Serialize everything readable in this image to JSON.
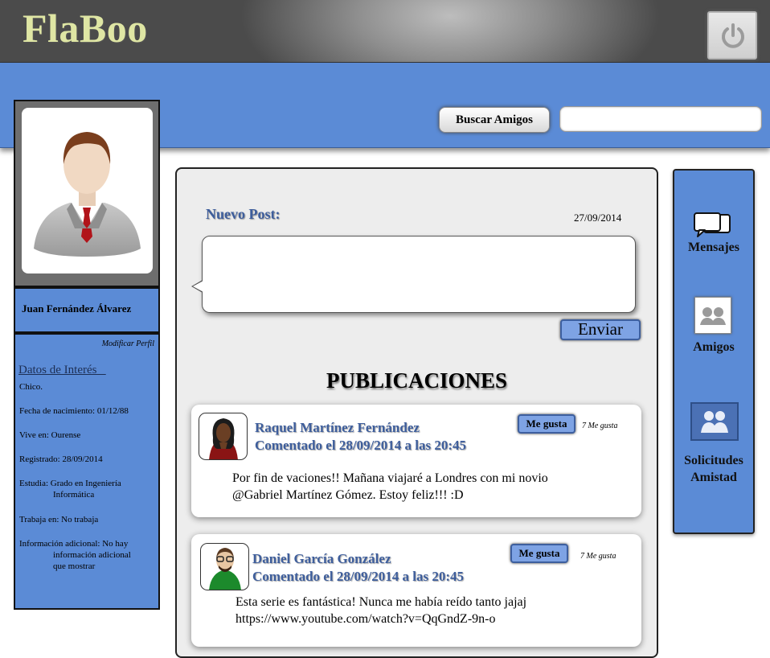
{
  "header": {
    "logo": "FlaBoo",
    "power_icon": "power-icon"
  },
  "search": {
    "button_label": "Buscar Amigos",
    "placeholder": ""
  },
  "profile": {
    "name": "Juan Fernández Álvarez",
    "modify_link": "Modificar Perfil",
    "interest_title": "Datos de Interés",
    "lines": [
      "Chico.",
      "Fecha de nacimiento: 01/12/88",
      "Vive en: Ourense",
      "Registrado: 28/09/2014"
    ],
    "studies_label": "Estudia: Grado en Ingeniería",
    "studies_cont": "Informática",
    "works": "Trabaja en: No trabaja",
    "extra_label": "Información adicional: No hay",
    "extra_cont1": "información adicional",
    "extra_cont2": "que mostrar"
  },
  "composer": {
    "title": "Nuevo Post:",
    "date": "27/09/2014",
    "send_label": "Enviar"
  },
  "feed": {
    "title": "PUBLICACIONES",
    "posts": [
      {
        "author": "Raquel Martínez Fernández",
        "meta": "Comentado el 28/09/2014 a las 20:45",
        "like_label": "Me gusta",
        "likes": "7 Me gusta",
        "body_line1": "Por fin de vaciones!! Mañana viajaré a Londres con mi novio",
        "body_line2": "@Gabriel Martínez Gómez. Estoy feliz!!! :D"
      },
      {
        "author": "Daniel García González",
        "meta": "Comentado el 28/09/2014 a las 20:45",
        "like_label": "Me gusta",
        "likes": "7 Me gusta",
        "body_line1": "Esta serie es fantástica! Nunca me había reído tanto jajaj",
        "body_line2": "https://www.youtube.com/watch?v=QqGndZ-9n-o"
      }
    ]
  },
  "sidebar_right": {
    "messages": "Mensajes",
    "friends": "Amigos",
    "requests_line1": "Solicitudes",
    "requests_line2": "Amistad"
  },
  "colors": {
    "primary_blue": "#5b8bd6",
    "button_blue": "#7ea3e4",
    "logo": "#dfe6a4",
    "link_blue": "#3e5e9c"
  }
}
